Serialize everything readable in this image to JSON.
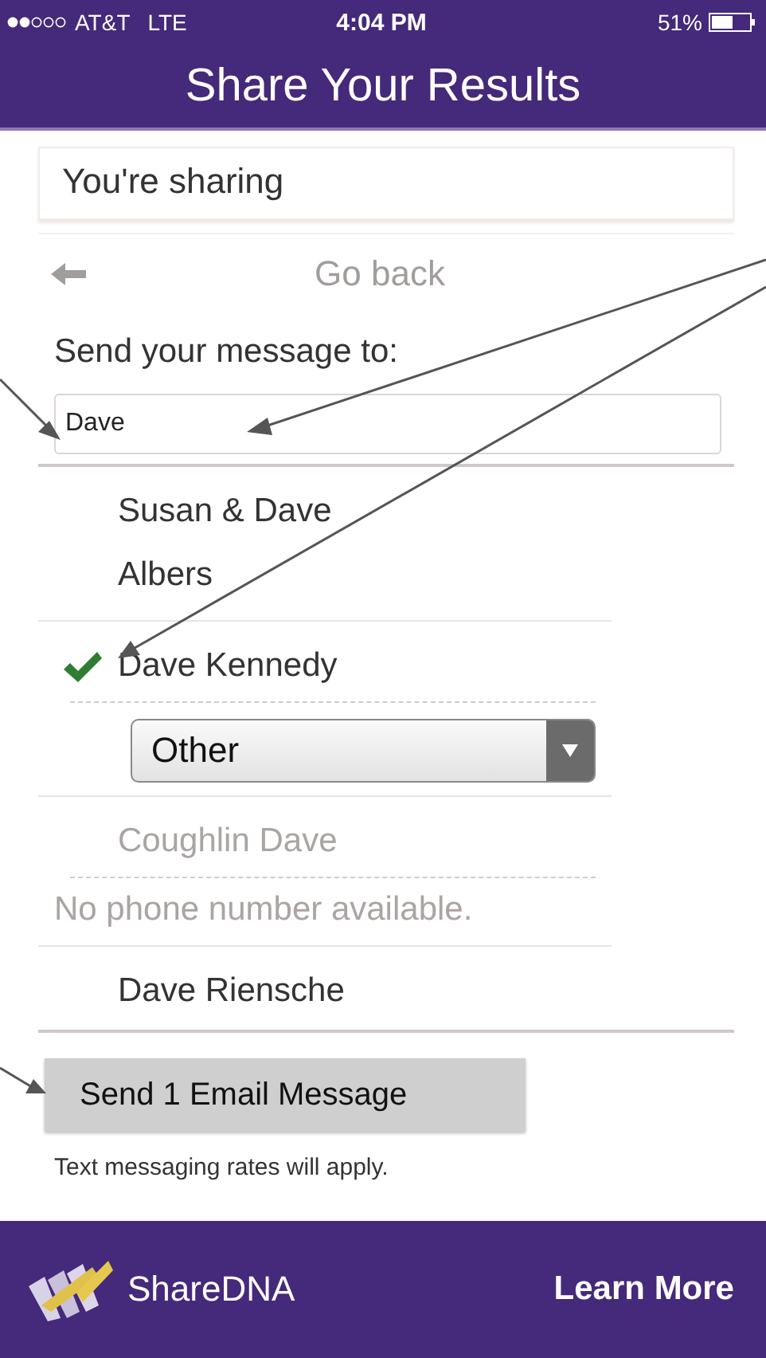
{
  "status_bar": {
    "carrier": "AT&T",
    "network": "LTE",
    "time": "4:04 PM",
    "battery": "51%"
  },
  "header": {
    "title": "Share Your Results"
  },
  "sharing": {
    "label": "You're sharing"
  },
  "back": {
    "label": "Go back"
  },
  "recipient": {
    "label": "Send your message to:",
    "value": "Dave"
  },
  "contacts": [
    {
      "name": "Susan & Dave Albers",
      "selected": false,
      "disabled": false
    },
    {
      "name": "Dave Kennedy",
      "selected": true,
      "disabled": false,
      "type_value": "Other"
    },
    {
      "name": "Coughlin Dave",
      "selected": false,
      "disabled": true,
      "note": "No phone number available."
    },
    {
      "name": "Dave Riensche",
      "selected": false,
      "disabled": false
    }
  ],
  "send_button": "Send 1 Email Message",
  "rates_note": "Text messaging rates will apply.",
  "footer": {
    "brand": "ShareDNA",
    "link": "Learn More"
  }
}
